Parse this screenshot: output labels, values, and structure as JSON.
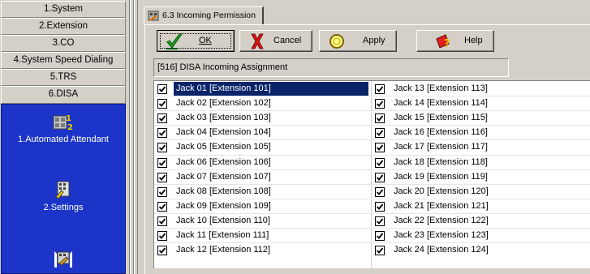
{
  "nav": {
    "items": [
      "1.System",
      "2.Extension",
      "3.CO",
      "4.System Speed Dialing",
      "5.TRS",
      "6.DISA"
    ],
    "panel": {
      "automated_attendant": "1.Automated Attendant",
      "settings": "2.Settings"
    }
  },
  "tab": {
    "label": "6.3 Incoming Permission"
  },
  "toolbar": {
    "ok_label": "OK",
    "cancel_label": "Cancel",
    "apply_label": "Apply",
    "help_label": "Help"
  },
  "section_title": "[516] DISA Incoming Assignment",
  "jacks": {
    "left": [
      {
        "label": "Jack 01 [Extension 101]",
        "checked": true,
        "selected": true
      },
      {
        "label": "Jack 02 [Extension 102]",
        "checked": true
      },
      {
        "label": "Jack 03 [Extension 103]",
        "checked": true
      },
      {
        "label": "Jack 04 [Extension 104]",
        "checked": true
      },
      {
        "label": "Jack 05 [Extension 105]",
        "checked": true
      },
      {
        "label": "Jack 06 [Extension 106]",
        "checked": true
      },
      {
        "label": "Jack 07 [Extension 107]",
        "checked": true
      },
      {
        "label": "Jack 08 [Extension 108]",
        "checked": true
      },
      {
        "label": "Jack 09 [Extension 109]",
        "checked": true
      },
      {
        "label": "Jack 10 [Extension 110]",
        "checked": true
      },
      {
        "label": "Jack 11 [Extension 111]",
        "checked": true
      },
      {
        "label": "Jack 12 [Extension 112]",
        "checked": true
      }
    ],
    "right": [
      {
        "label": "Jack 13 [Extension 113]",
        "checked": true
      },
      {
        "label": "Jack 14 [Extension 114]",
        "checked": true
      },
      {
        "label": "Jack 15 [Extension 115]",
        "checked": true
      },
      {
        "label": "Jack 16 [Extension 116]",
        "checked": true
      },
      {
        "label": "Jack 17 [Extension 117]",
        "checked": true
      },
      {
        "label": "Jack 18 [Extension 118]",
        "checked": true
      },
      {
        "label": "Jack 19 [Extension 119]",
        "checked": true
      },
      {
        "label": "Jack 20 [Extension 120]",
        "checked": true
      },
      {
        "label": "Jack 21 [Extension 121]",
        "checked": true
      },
      {
        "label": "Jack 22 [Extension 122]",
        "checked": true
      },
      {
        "label": "Jack 23 [Extension 123]",
        "checked": true
      },
      {
        "label": "Jack 24 [Extension 124]",
        "checked": true
      }
    ]
  },
  "colors": {
    "panel_blue": "#1c35c8",
    "selection": "#0a246a",
    "window_gray": "#d4d0c8"
  },
  "icons": {
    "tab": "incoming-permission-icon",
    "ok": "checkmark-icon",
    "cancel": "x-icon",
    "apply": "apply-circle-icon",
    "help": "help-icon",
    "panel": [
      "automated-attendant-icon",
      "settings-icon",
      "disa-tool-icon"
    ]
  }
}
